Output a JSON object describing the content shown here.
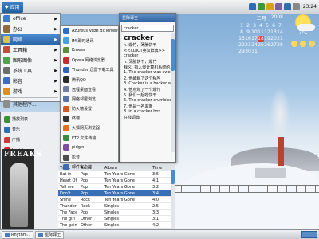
{
  "top_panel": {
    "menu_label": "应用",
    "clock": "23:24",
    "tray_colors": [
      "#2f6db3",
      "#3a9a3a",
      "#d9a21b",
      "#7b5ea7",
      "#2f6db3",
      "#888888"
    ]
  },
  "calendar": {
    "month": "十二月",
    "year": "2008",
    "days": [
      "1",
      "2",
      "3",
      "4",
      "5",
      "6",
      "7",
      "8",
      "9",
      "10",
      "11",
      "12",
      "13",
      "14",
      "15",
      "16",
      "17",
      "18",
      "19",
      "20",
      "21",
      "22",
      "23",
      "24",
      "25",
      "26",
      "27",
      "28",
      "29",
      "30",
      "31"
    ],
    "today": "18"
  },
  "weather": {
    "temp": "7°C"
  },
  "start_menu": {
    "items": [
      {
        "label": "office",
        "icon": "office-icon",
        "color": "#3b7bd4",
        "has_sub": true
      },
      {
        "label": "办公",
        "icon": "briefcase-icon",
        "color": "#8b6e3c",
        "has_sub": true
      },
      {
        "label": "网络",
        "icon": "network-icon",
        "color": "#d8c44a",
        "has_sub": true,
        "active": true
      },
      {
        "label": "工具箱",
        "icon": "toolbox-icon",
        "color": "#c94a3a",
        "has_sub": true
      },
      {
        "label": "图形图像",
        "icon": "image-icon",
        "color": "#4fa34a",
        "has_sub": true
      },
      {
        "label": "系统工具",
        "icon": "system-icon",
        "color": "#6d6d6d",
        "has_sub": true
      },
      {
        "label": "影音",
        "icon": "media-icon",
        "color": "#3e6cc1",
        "has_sub": true
      },
      {
        "label": "游戏",
        "icon": "game-icon",
        "color": "#e38b1d",
        "has_sub": true
      },
      {
        "label": "其他程序...",
        "icon": "more-icon",
        "color": "#8c8c8c",
        "has_sub": false
      }
    ]
  },
  "submenu": {
    "items": [
      {
        "label": "Azureus Vuze BitTorrent",
        "color": "#2a6fc9"
      },
      {
        "label": "IM 即时通讯",
        "color": "#44a2e0"
      },
      {
        "label": "Kmess",
        "color": "#5b8f3b"
      },
      {
        "label": "Opera 网络浏览器",
        "color": "#c72d2d"
      },
      {
        "label": "Thunder 迅雷下载工具",
        "color": "#2f65b7"
      },
      {
        "label": "腾讯QQ",
        "color": "#2b2b2b"
      },
      {
        "label": "远程桌面查看",
        "color": "#6e7fa3"
      },
      {
        "label": "网络邻居浏览",
        "color": "#5774a8"
      },
      {
        "label": "防火墙设置",
        "color": "#d6571f"
      },
      {
        "label": "终端",
        "color": "#333333"
      },
      {
        "label": "火狐网页浏览器",
        "color": "#e2701f"
      },
      {
        "label": "FTP 文件传输",
        "color": "#3c8a3c"
      },
      {
        "label": "pidgin",
        "color": "#7c4fa1"
      },
      {
        "label": "影音",
        "color": "#4d4d4d"
      },
      {
        "label": "邮件客户端",
        "color": "#3a6bb3"
      }
    ]
  },
  "dictionary": {
    "title": "星际译王",
    "query": "cracker",
    "word": "cracker",
    "lines": [
      "n. 爆竹，薄脆饼干",
      "<<XDICT英汉辞典>>",
      "cracker",
      "n. 薄脆饼干，爆竹",
      "释义: 指入侵计算机系统的人",
      "1. The cracker was sweet and crunchy",
      "2. 他破解了这个程序",
      "3. Cracker is a hacker who...",
      "4. 他点燃了一个爆竹",
      "5. 我们一起吃饼干",
      "6. The cracker crumbled...",
      "7. 他是一名黑客",
      "8. in a cracker box",
      "在线词典"
    ]
  },
  "player": {
    "tabs": [
      {
        "label": "播放列表",
        "color": "#3a8f3a"
      },
      {
        "label": "音乐",
        "color": "#2f6db3"
      },
      {
        "label": "广播",
        "color": "#c53b3b"
      },
      {
        "label": "Last.fm",
        "color": "#d02a2a"
      }
    ],
    "album_title": "FREAKS",
    "tracks_header": [
      "Track",
      "Artist",
      "Album",
      "Time"
    ],
    "tracks": [
      {
        "track": "Rat in",
        "artist": "Pop",
        "album": "Ten Years Gone",
        "time": "3:5",
        "selected": false
      },
      {
        "track": "Heart Of",
        "artist": "Pop",
        "album": "Ten Years Gone",
        "time": "4:1",
        "selected": false
      },
      {
        "track": "Tell me",
        "artist": "Pop",
        "album": "Ten Years Gone",
        "time": "3:2",
        "selected": false
      },
      {
        "track": "Don't",
        "artist": "Pop",
        "album": "Ten Years Gone",
        "time": "3:4",
        "selected": true
      },
      {
        "track": "Shine",
        "artist": "Rock",
        "album": "Ten Years Gone",
        "time": "4:0",
        "selected": false
      },
      {
        "track": "Thunder",
        "artist": "Rock",
        "album": "Singles",
        "time": "2:5",
        "selected": false
      },
      {
        "track": "The Face",
        "artist": "Pop",
        "album": "Singles",
        "time": "3:3",
        "selected": false
      },
      {
        "track": "The girl",
        "artist": "Other",
        "album": "Singles",
        "time": "3:1",
        "selected": false
      },
      {
        "track": "The gain",
        "artist": "Other",
        "album": "Singles",
        "time": "4:2",
        "selected": false
      }
    ]
  },
  "bottom_panel": {
    "tasks": [
      {
        "label": "Rhythm..."
      },
      {
        "label": "星际译王"
      }
    ]
  }
}
